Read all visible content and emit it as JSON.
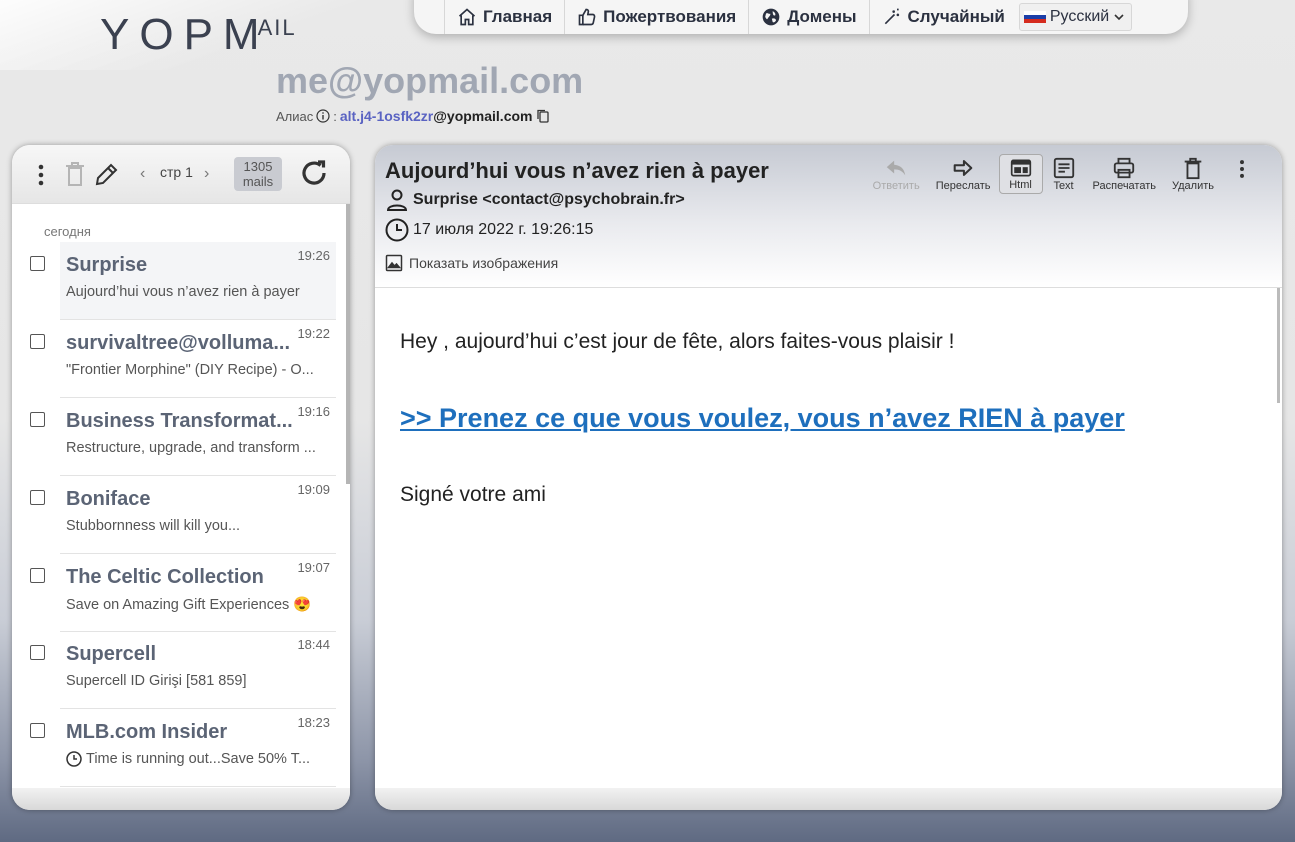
{
  "logo": {
    "main": "YOPM",
    "suffix": "AIL"
  },
  "topnav": {
    "items": [
      {
        "label": "Главная",
        "icon": "home-icon"
      },
      {
        "label": "Пожертвования",
        "icon": "thumbs-up-icon"
      },
      {
        "label": "Домены",
        "icon": "globe-icon"
      },
      {
        "label": "Случайный",
        "icon": "magic-wand-icon"
      }
    ],
    "language": "Русский"
  },
  "mailbox": {
    "address": "me@yopmail.com",
    "alias_label": "Алиас",
    "alias_sep": ":",
    "alias_prefix": "alt.j4-1osfk2zr",
    "alias_domain": "@yopmail.com"
  },
  "list_toolbar": {
    "page": "стр 1",
    "count_num": "1305",
    "count_unit": "mails"
  },
  "list": {
    "day_label": "сегодня",
    "items": [
      {
        "from": "Surprise",
        "time": "19:26",
        "subject": "Aujourd’hui vous n’avez rien à payer"
      },
      {
        "from": "survivaltree@volluma...",
        "time": "19:22",
        "subject": "\"Frontier Morphine\" (DIY Recipe) - O..."
      },
      {
        "from": "Business Transformat...",
        "time": "19:16",
        "subject": "Restructure, upgrade, and transform ..."
      },
      {
        "from": "Boniface",
        "time": "19:09",
        "subject": "Stubbornness will kill you..."
      },
      {
        "from": "The Celtic Collection",
        "time": "19:07",
        "subject": "Save on Amazing Gift Experiences",
        "emoji": "😍"
      },
      {
        "from": "Supercell",
        "time": "18:44",
        "subject": "Supercell ID Girişi [581 859]"
      },
      {
        "from": "MLB.com Insider",
        "time": "18:23",
        "subject": "Time is running out...Save 50% T..."
      }
    ]
  },
  "message": {
    "subject": "Aujourd’hui vous n’avez rien à payer",
    "from": "Surprise <contact@psychobrain.fr>",
    "date": "17 июля 2022 г. 19:26:15",
    "show_images": "Показать изображения",
    "tools": {
      "reply": "Ответить",
      "forward": "Переслать",
      "html": "Html",
      "text": "Text",
      "print": "Распечатать",
      "delete": "Удалить"
    },
    "body": {
      "line1": "Hey , aujourd’hui c’est jour de fête, alors faites-vous plaisir !",
      "link": ">> Prenez ce que vous voulez, vous n’avez RIEN à payer",
      "line3": "Signé votre ami"
    }
  },
  "colors": {
    "accent": "#1e6fbd",
    "alias_prefix": "#5a63c2",
    "sender": "#5b6475"
  }
}
